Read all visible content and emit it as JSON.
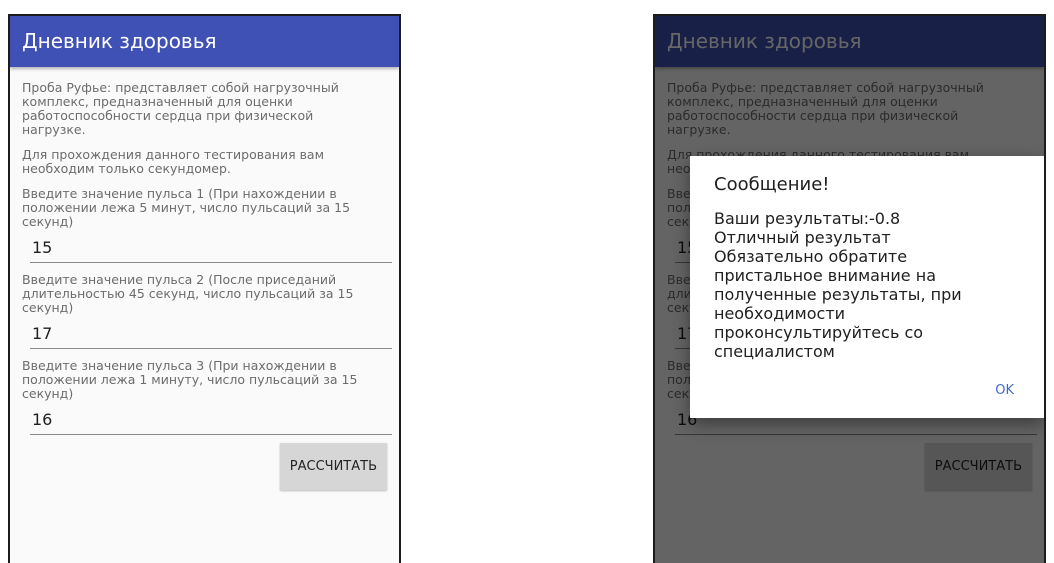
{
  "app": {
    "title": "Дневник здоровья"
  },
  "intro": {
    "description": "Проба Руфье: представляет собой нагрузочный\nкомплекс, предназначенный для оценки\nработоспособности сердца при физической\nнагрузке.",
    "instruction": "Для прохождения данного тестирования вам\nнеобходим только секундомер."
  },
  "fields": [
    {
      "label": "Введите значение пульса 1 (При нахождении в\nположении лежа 5 минут, число пульсаций за 15\nсекунд)",
      "value": "15"
    },
    {
      "label": "Введите значение пульса 2 (После приседаний\nдлительностью 45 секунд, число пульсаций за 15\nсекунд)",
      "value": "17"
    },
    {
      "label": "Введите значение пульса 3 (При нахождении в\nположении лежа 1 минуту, число пульсаций за 15\nсекунд)",
      "value": "16"
    }
  ],
  "button": {
    "calculate": "РАССЧИТАТЬ"
  },
  "dialog": {
    "title": "Сообщение!",
    "message": "Ваши результаты:-0.8\nОтличный результат\nОбязательно обратите\nпристальное внимание на\nполученные результаты, при\nнеобходимости\nпроконсультируйтесь со\nспециалистом",
    "ok": "OK"
  },
  "colors": {
    "appbar": "#3f51b5",
    "accent": "#3f6cc4",
    "button": "#d6d6d6"
  }
}
